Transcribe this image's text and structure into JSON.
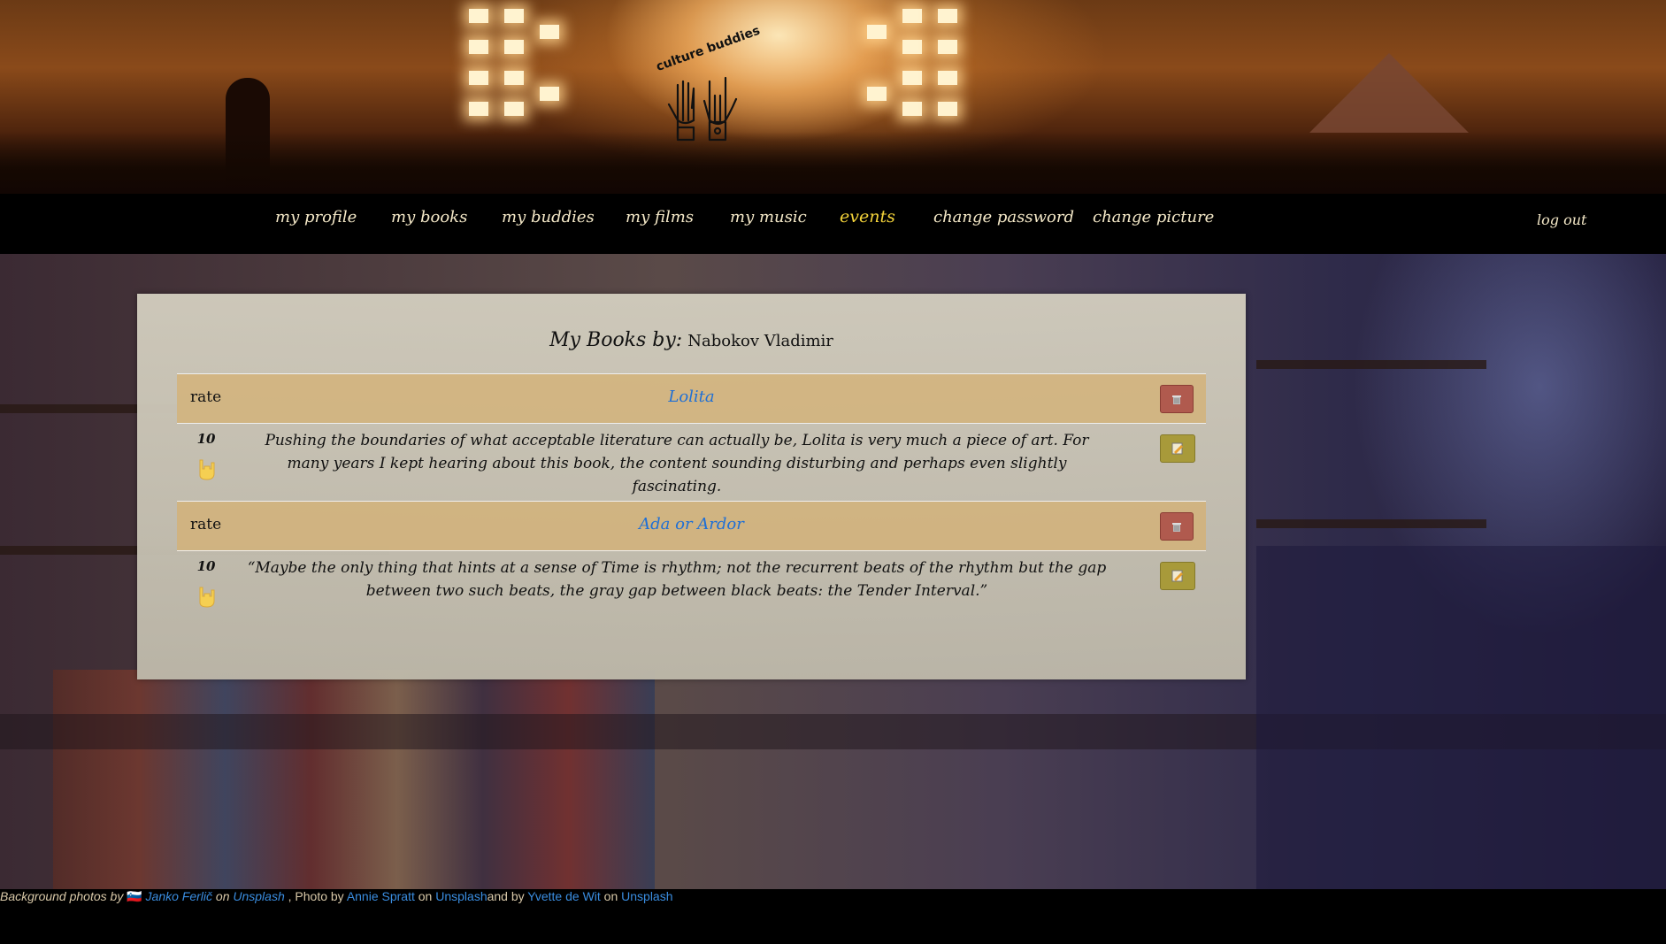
{
  "logo": {
    "text": "culture buddies"
  },
  "nav": {
    "items": [
      {
        "label": "my profile"
      },
      {
        "label": "my books"
      },
      {
        "label": "my buddies"
      },
      {
        "label": "my films"
      },
      {
        "label": "my music"
      },
      {
        "label": "events",
        "active": true
      },
      {
        "label": "change password"
      },
      {
        "label": "change picture"
      }
    ],
    "logout": "log out"
  },
  "card": {
    "title_label": "My Books by:",
    "author": "Nabokov Vladimir",
    "books": [
      {
        "rate_label": "rate",
        "title": "Lolita",
        "rating": "10",
        "review": "Pushing the boundaries of what acceptable literature can actually be, Lolita is very much a piece of art. For many years I kept hearing about this book, the content sounding disturbing and perhaps even slightly fascinating."
      },
      {
        "rate_label": "rate",
        "title": "Ada or Ardor",
        "rating": "10",
        "review": "“Maybe the only thing that hints at a sense of Time is rhythm; not the recurrent beats of the rhythm but the gap between two such beats, the gray gap between black beats: the Tender Interval.”"
      }
    ]
  },
  "footer": {
    "prefix": "Background photos by",
    "flag": "🇸🇮",
    "author1": "Janko Ferlič",
    "on1": "on",
    "site1": "Unsplash",
    "photo_by": ", Photo by",
    "author2": "Annie Spratt",
    "on2": "on",
    "site2": "Unsplash",
    "and_by": "and by",
    "author3": "Yvette de Wit",
    "on3": "on",
    "site3": "Unsplash"
  },
  "colors": {
    "link": "#1e6fd6",
    "nav_active": "#f3d23a",
    "delete": "#b05a4e",
    "edit": "#a89a3a",
    "row_header": "#d6b070"
  }
}
